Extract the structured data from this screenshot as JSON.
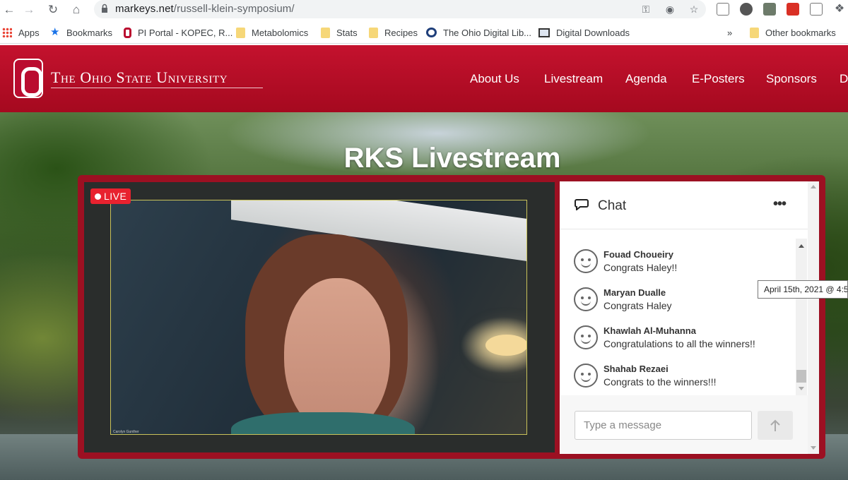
{
  "browser": {
    "url_domain": "markeys.net",
    "url_path": "/russell-klein-symposium/",
    "bookmarks": [
      {
        "label": "Apps",
        "icon": "apps-grid-icon"
      },
      {
        "label": "Bookmarks",
        "icon": "star-icon"
      },
      {
        "label": "PI Portal - KOPEC, R...",
        "icon": "osu-block-o-icon"
      },
      {
        "label": "Metabolomics",
        "icon": "folder-icon"
      },
      {
        "label": "Stats",
        "icon": "folder-icon"
      },
      {
        "label": "Recipes",
        "icon": "folder-icon"
      },
      {
        "label": "The Ohio Digital Lib...",
        "icon": "ohio-digital-library-icon"
      },
      {
        "label": "Digital Downloads",
        "icon": "monitor-icon"
      }
    ],
    "overflow_label": "»",
    "other_bookmarks": "Other bookmarks"
  },
  "site": {
    "university_name": "The Ohio State University",
    "nav": [
      "About Us",
      "Livestream",
      "Agenda",
      "E-Posters",
      "Sponsors",
      "D"
    ],
    "page_title": "RKS Livestream",
    "brand_color": "#ba0c2f"
  },
  "video": {
    "live_label": "LIVE",
    "caption": "Carolyn Gunther"
  },
  "chat": {
    "title": "Chat",
    "more_label": "•••",
    "messages": [
      {
        "author": "Fouad Choueiry",
        "text": "Congrats Haley!!"
      },
      {
        "author": "Maryan Dualle",
        "text": "Congrats Haley"
      },
      {
        "author": "Khawlah Al-Muhanna",
        "text": "Congratulations to all the winners!!"
      },
      {
        "author": "Shahab Rezaei",
        "text": "Congrats to the winners!!!"
      }
    ],
    "input_placeholder": "Type a message",
    "tooltip": "April 15th, 2021 @ 4:5"
  }
}
